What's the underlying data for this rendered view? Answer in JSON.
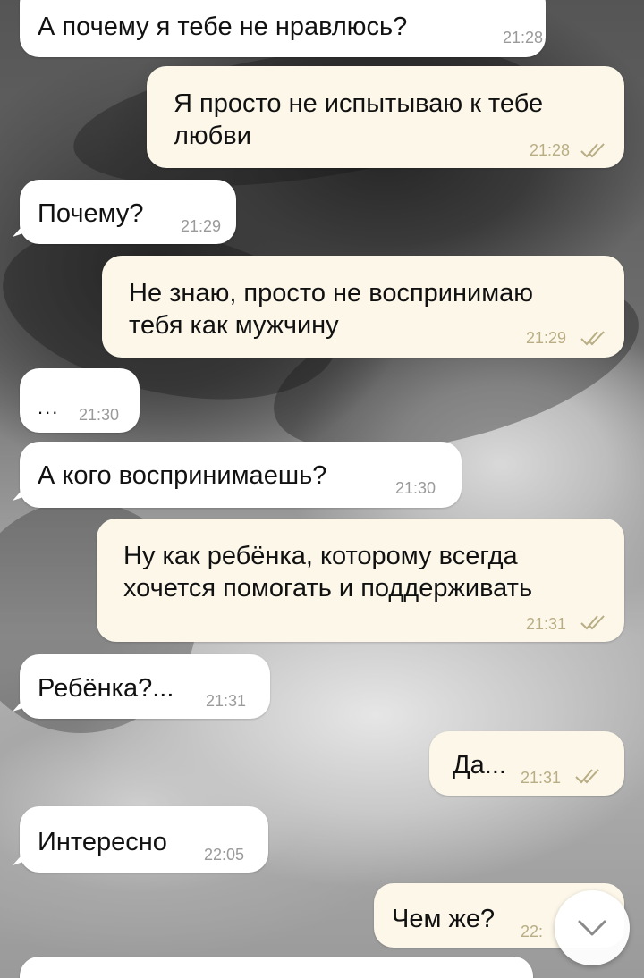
{
  "messages": [
    {
      "dir": "in",
      "text": "А почему я тебе не нравлюсь?",
      "time": "21:28",
      "read": false
    },
    {
      "dir": "out",
      "text": "Я просто не испытываю к тебе\nлюбви",
      "time": "21:28",
      "read": true
    },
    {
      "dir": "in",
      "text": "Почему?",
      "time": "21:29",
      "read": false
    },
    {
      "dir": "out",
      "text": "Не знаю, просто не воспринимаю\nтебя как мужчину",
      "time": "21:29",
      "read": true
    },
    {
      "dir": "in",
      "text": "...",
      "time": "21:30",
      "read": false
    },
    {
      "dir": "in",
      "text": "А кого воспринимаешь?",
      "time": "21:30",
      "read": false
    },
    {
      "dir": "out",
      "text": "Ну как ребёнка, которому всегда\nхочется помогать и поддерживать",
      "time": "21:31",
      "read": true
    },
    {
      "dir": "in",
      "text": "Ребёнка?...",
      "time": "21:31",
      "read": false
    },
    {
      "dir": "out",
      "text": "Да...",
      "time": "21:31",
      "read": true
    },
    {
      "dir": "in",
      "text": "Интересно",
      "time": "22:05",
      "read": false
    },
    {
      "dir": "out",
      "text": "Чем же?",
      "time": "22:",
      "read": false
    }
  ],
  "scroll_button": {
    "icon": "chevron-down-icon"
  },
  "colors": {
    "incoming_bubble": "#ffffff",
    "outgoing_bubble": "#fcf7e9",
    "read_check": "#b9ad84"
  }
}
